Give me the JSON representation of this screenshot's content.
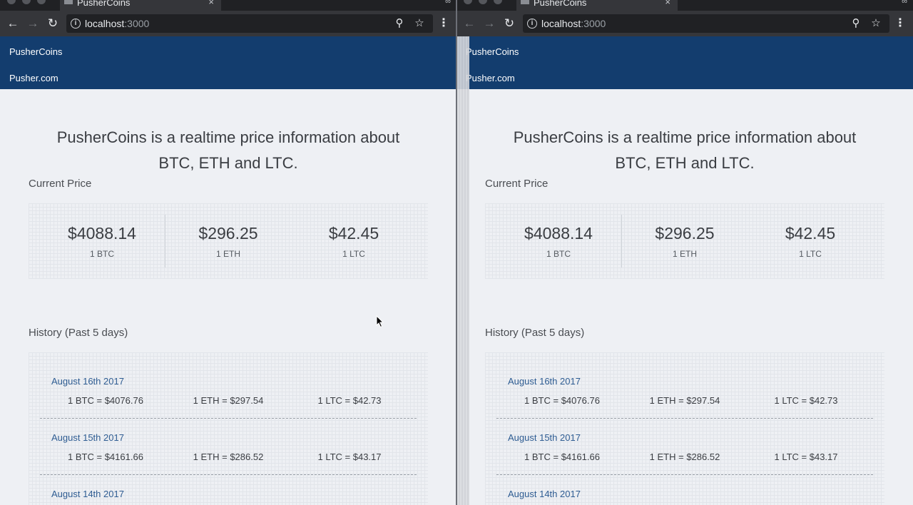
{
  "browser": {
    "tab_title": "PusherCoins",
    "tab_close": "×",
    "profile_glyph": "∞",
    "url_host": "localhost",
    "url_port": ":3000"
  },
  "app": {
    "brand": "PusherCoins",
    "nav_link": "Pusher.com"
  },
  "hero": {
    "line1": "PusherCoins is a realtime price information about",
    "line2": "BTC, ETH and LTC."
  },
  "current_price": {
    "title": "Current Price",
    "items": [
      {
        "value": "$4088.14",
        "unit": "1 BTC"
      },
      {
        "value": "$296.25",
        "unit": "1 ETH"
      },
      {
        "value": "$42.45",
        "unit": "1 LTC"
      }
    ]
  },
  "history": {
    "title": "History (Past 5 days)",
    "entries": [
      {
        "date": "August 16th 2017",
        "btc": "1 BTC = $4076.76",
        "eth": "1 ETH = $297.54",
        "ltc": "1 LTC = $42.73"
      },
      {
        "date": "August 15th 2017",
        "btc": "1 BTC = $4161.66",
        "eth": "1 ETH = $286.52",
        "ltc": "1 LTC = $43.17"
      },
      {
        "date": "August 14th 2017",
        "btc": "",
        "eth": "",
        "ltc": ""
      }
    ]
  },
  "icons": {
    "back": "←",
    "forward": "→",
    "reload": "↻",
    "info": "i",
    "zoom": "⚲",
    "star": "☆",
    "menu": "⋮"
  }
}
